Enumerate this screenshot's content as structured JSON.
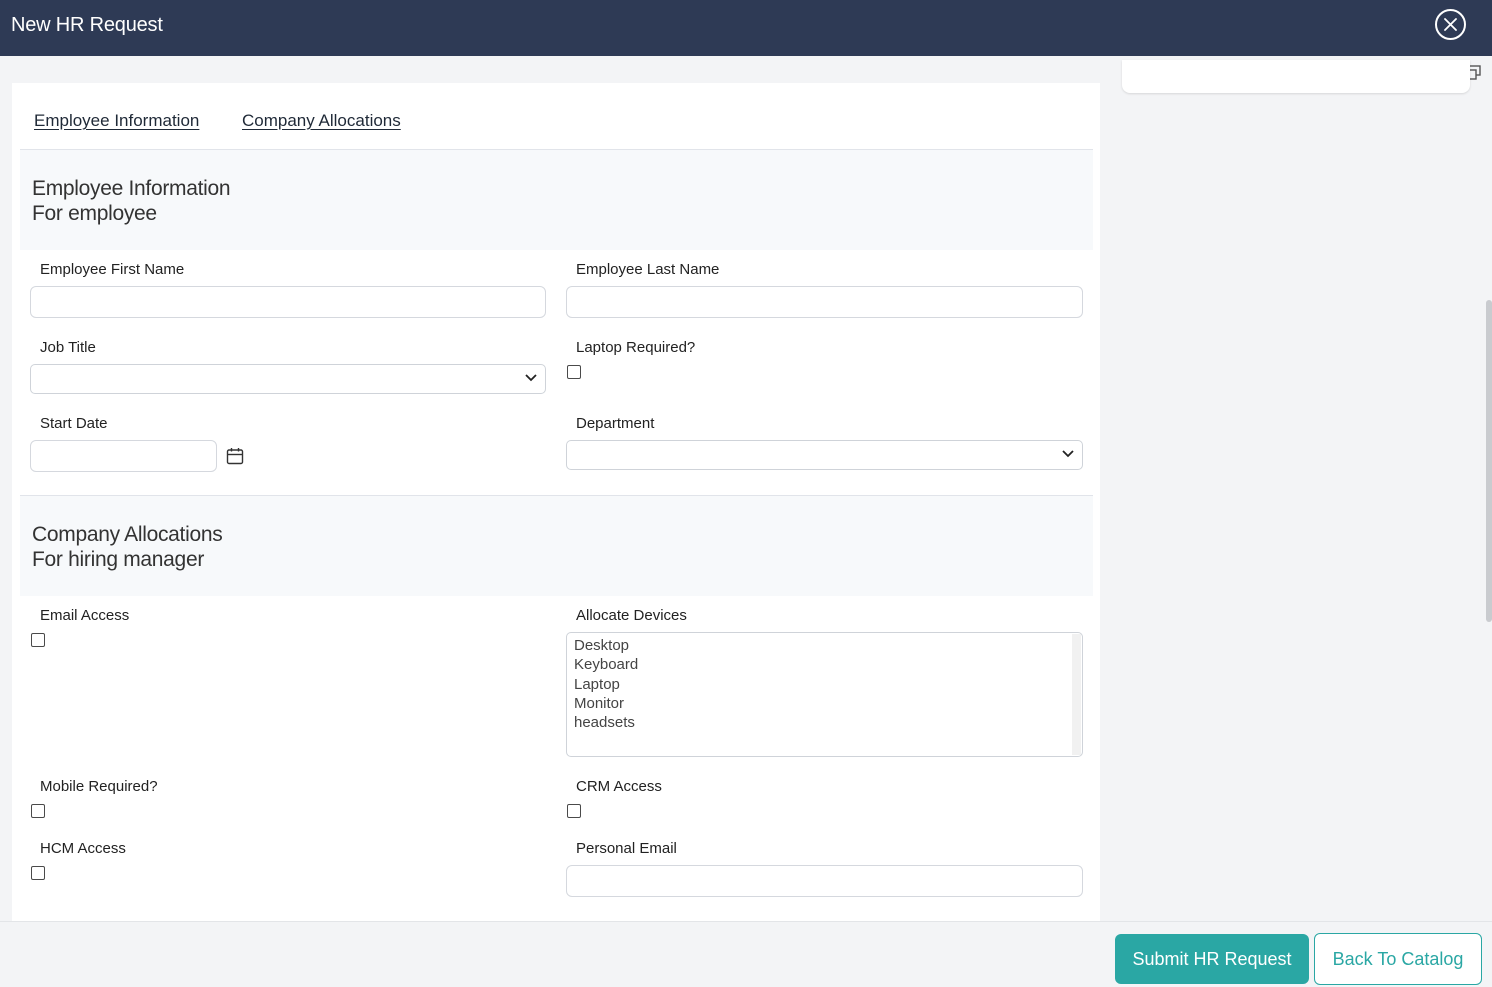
{
  "header": {
    "title": "New HR Request"
  },
  "tabs": [
    {
      "label": "Employee Information"
    },
    {
      "label": "Company Allocations"
    }
  ],
  "sections": {
    "employee": {
      "title": "Employee Information",
      "subtitle": "For employee"
    },
    "company": {
      "title": "Company Allocations",
      "subtitle": "For hiring manager"
    }
  },
  "fields": {
    "first_name": {
      "label": "Employee First Name",
      "value": ""
    },
    "last_name": {
      "label": "Employee Last Name",
      "value": ""
    },
    "job_title": {
      "label": "Job Title",
      "value": ""
    },
    "laptop_required": {
      "label": "Laptop Required?",
      "checked": false
    },
    "start_date": {
      "label": "Start Date",
      "value": ""
    },
    "department": {
      "label": "Department",
      "value": ""
    },
    "email_access": {
      "label": "Email Access",
      "checked": false
    },
    "allocate_devices": {
      "label": "Allocate Devices",
      "options": [
        "Desktop",
        "Keyboard",
        "Laptop",
        "Monitor",
        "headsets"
      ]
    },
    "mobile_required": {
      "label": "Mobile Required?",
      "checked": false
    },
    "crm_access": {
      "label": "CRM Access",
      "checked": false
    },
    "hcm_access": {
      "label": "HCM Access",
      "checked": false
    },
    "personal_email": {
      "label": "Personal Email",
      "value": ""
    }
  },
  "footer": {
    "submit_label": "Submit HR Request",
    "back_label": "Back To Catalog"
  },
  "icons": {
    "close": "close-icon",
    "restore": "restore-window-icon",
    "calendar": "calendar-icon",
    "chevron": "chevron-down-icon"
  },
  "colors": {
    "header_bg": "#2e3a55",
    "accent": "#2aa7a4",
    "page_bg": "#f3f4f6"
  }
}
